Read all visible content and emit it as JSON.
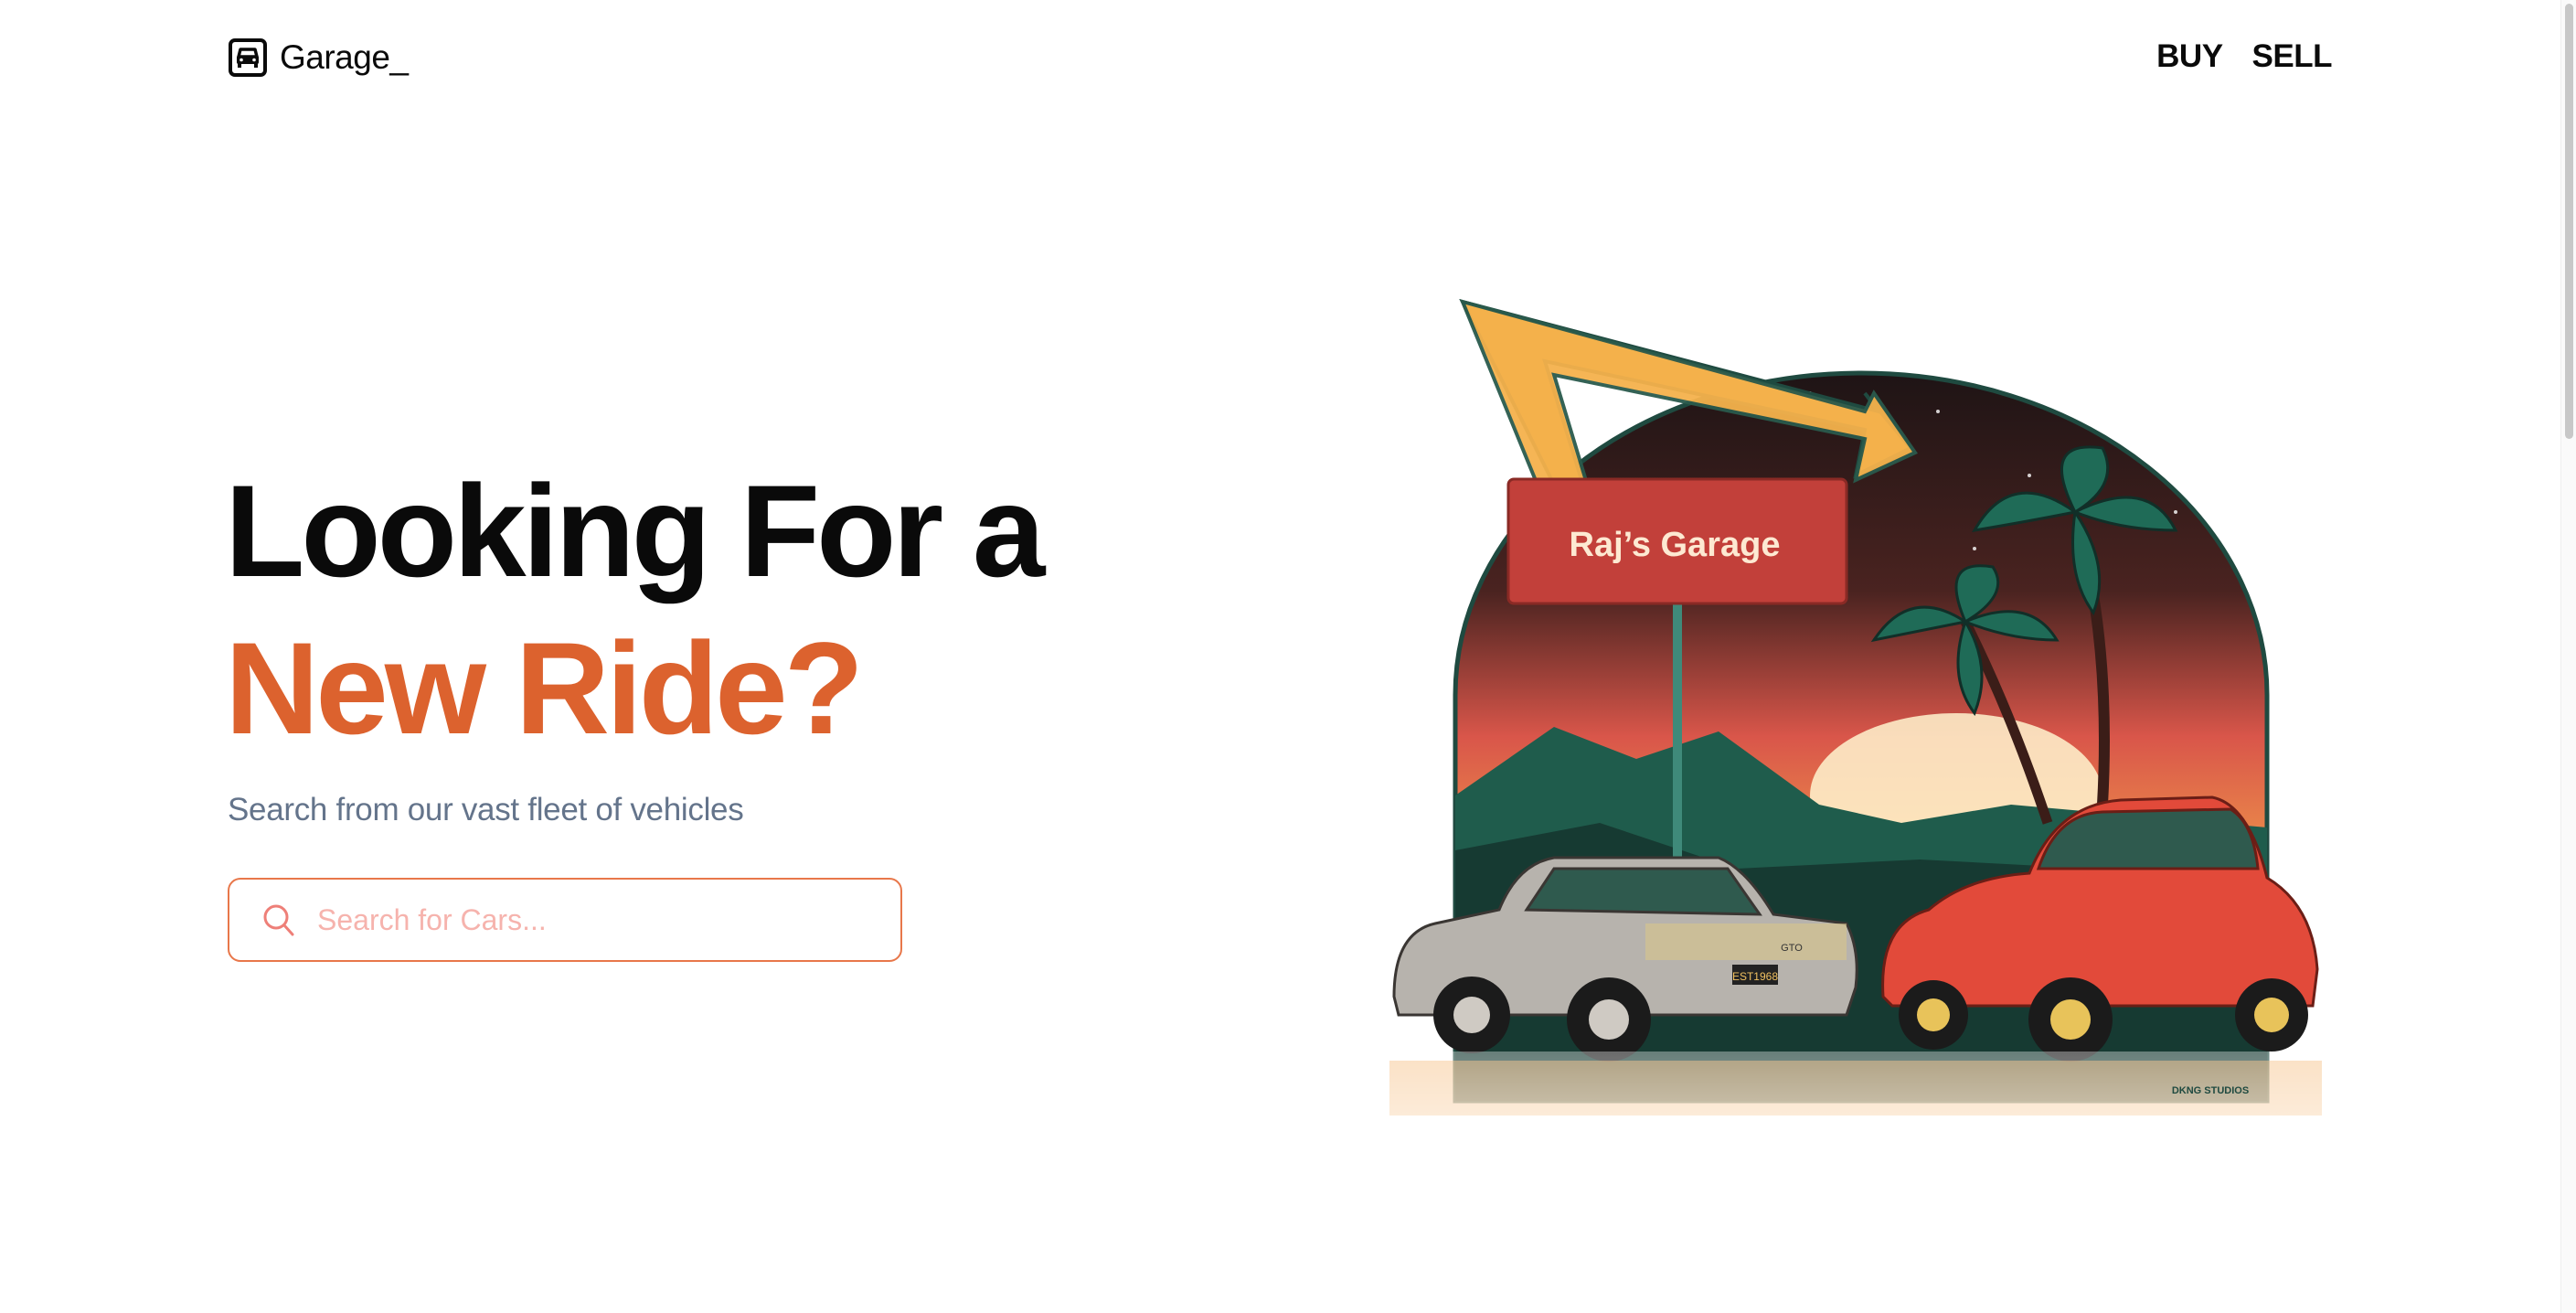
{
  "header": {
    "logo_text": "Garage_",
    "logo_icon": "car-front-icon",
    "nav": [
      {
        "label": "BUY"
      },
      {
        "label": "SELL"
      }
    ]
  },
  "hero": {
    "title_line1": "Looking For a",
    "title_line2": "New Ride?",
    "subtitle": "Search from our vast fleet of vehicles",
    "search": {
      "placeholder": "Search for Cars...",
      "value": "",
      "icon": "search-icon"
    },
    "illustration": {
      "sign_text": "Raj’s Garage",
      "plate_text": "EST1968",
      "badge_text": "GTO",
      "credit_text": "DKNG STUDIOS"
    }
  },
  "colors": {
    "accent": "#dc622e",
    "subtitle": "#64748b",
    "search_border": "#e8774a",
    "placeholder": "#f6b3ad"
  }
}
